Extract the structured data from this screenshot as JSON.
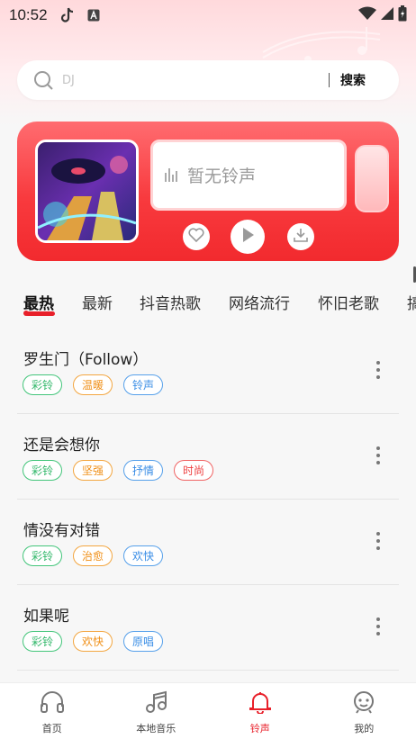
{
  "status_bar": {
    "time": "10:52"
  },
  "search": {
    "placeholder": "DJ",
    "button_label": "搜索"
  },
  "player": {
    "empty_text": "暂无铃声"
  },
  "tabs": [
    "最热",
    "最新",
    "抖音热歌",
    "网络流行",
    "怀旧老歌",
    "搞"
  ],
  "active_tab": 0,
  "songs": [
    {
      "title": "罗生门（Follow）",
      "tags": [
        {
          "label": "彩铃",
          "color": "green"
        },
        {
          "label": "温暖",
          "color": "orange"
        },
        {
          "label": "铃声",
          "color": "blue"
        }
      ]
    },
    {
      "title": "还是会想你",
      "tags": [
        {
          "label": "彩铃",
          "color": "green"
        },
        {
          "label": "坚强",
          "color": "orange"
        },
        {
          "label": "抒情",
          "color": "blue"
        },
        {
          "label": "时尚",
          "color": "red"
        }
      ]
    },
    {
      "title": "情没有对错",
      "tags": [
        {
          "label": "彩铃",
          "color": "green"
        },
        {
          "label": "治愈",
          "color": "orange"
        },
        {
          "label": "欢快",
          "color": "blue"
        }
      ]
    },
    {
      "title": "如果呢",
      "tags": [
        {
          "label": "彩铃",
          "color": "green"
        },
        {
          "label": "欢快",
          "color": "orange"
        },
        {
          "label": "原唱",
          "color": "blue"
        }
      ]
    }
  ],
  "nav": [
    {
      "label": "首页",
      "icon": "headphones-icon"
    },
    {
      "label": "本地音乐",
      "icon": "music-note-icon"
    },
    {
      "label": "铃声",
      "icon": "bell-icon",
      "active": true
    },
    {
      "label": "我的",
      "icon": "profile-icon"
    }
  ],
  "colors": {
    "accent": "#e8202a",
    "card": "#f83a3e"
  }
}
